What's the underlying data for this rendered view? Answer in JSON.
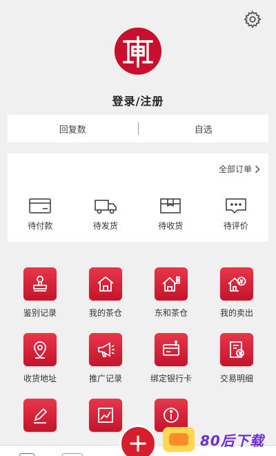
{
  "profile": {
    "login_label": "登录/注册"
  },
  "stats": {
    "left": "回复数",
    "right": "自选"
  },
  "orders": {
    "all_label": "全部订单",
    "items": [
      {
        "label": "待付款",
        "icon": "card-icon"
      },
      {
        "label": "待发货",
        "icon": "truck-icon"
      },
      {
        "label": "待收货",
        "icon": "box-icon"
      },
      {
        "label": "待评价",
        "icon": "comment-icon"
      }
    ]
  },
  "services": [
    {
      "label": "鉴别记录",
      "icon": "stamp-icon"
    },
    {
      "label": "我的茶仓",
      "icon": "house-icon"
    },
    {
      "label": "东和茶仓",
      "icon": "house-tag-icon"
    },
    {
      "label": "我的卖出",
      "icon": "house-yen-icon"
    },
    {
      "label": "收货地址",
      "icon": "location-icon"
    },
    {
      "label": "推广记录",
      "icon": "megaphone-icon"
    },
    {
      "label": "绑定银行卡",
      "icon": "bank-card-icon"
    },
    {
      "label": "交易明细",
      "icon": "receipt-yen-icon"
    },
    {
      "label": "",
      "icon": "edit-icon"
    },
    {
      "label": "",
      "icon": "trend-chart-icon"
    },
    {
      "label": "",
      "icon": "info-icon"
    }
  ],
  "watermark": {
    "text": "80后下载"
  },
  "colors": {
    "brand_red": "#d81e2a",
    "background": "#f0f0f0"
  }
}
